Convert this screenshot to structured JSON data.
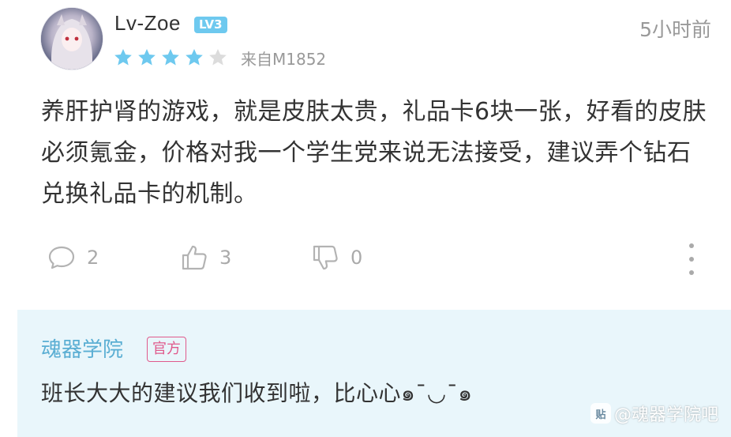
{
  "review": {
    "username": "Lv-Zoe",
    "level_badge": "LV3",
    "time": "5小时前",
    "rating": {
      "value": 4,
      "max": 5
    },
    "device": "来自M1852",
    "content": "养肝护肾的游戏，就是皮肤太贵，礼品卡6块一张，好看的皮肤必须氪金，价格对我一个学生党来说无法接受，建议弄个钻石兑换礼品卡的机制。",
    "actions": {
      "comments": "2",
      "likes": "3",
      "dislikes": "0"
    }
  },
  "reply": {
    "author": "魂器学院",
    "badge": "官方",
    "text": "班长大大的建议我们收到啦，比心心๑¯◡¯๑"
  },
  "watermark": {
    "text": "@魂器学院吧",
    "logo": "贴"
  },
  "colors": {
    "star_filled": "#6ec9ef",
    "star_empty": "#dcdcdc",
    "reply_name": "#5aaed3",
    "official_badge": "#e05a8c",
    "reply_background": "#e9f6fb",
    "level_badge": "#6ec9ef"
  },
  "icons": {
    "comments": "comment-bubble-icon",
    "likes": "thumbs-up-icon",
    "dislikes": "thumbs-down-icon",
    "more": "more-vertical-icon"
  }
}
